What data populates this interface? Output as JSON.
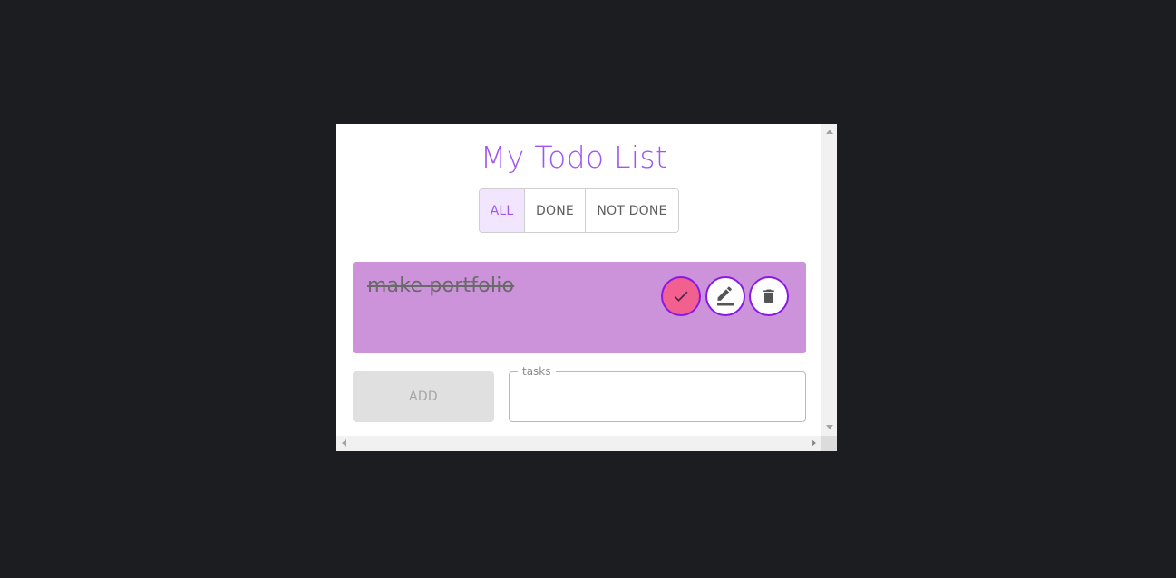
{
  "app": {
    "title": "My Todo List"
  },
  "filters": {
    "all": "ALL",
    "done": "DONE",
    "not_done": "NOT DONE",
    "active": "all"
  },
  "tasks": [
    {
      "text": "make portfolio",
      "completed": true
    }
  ],
  "actions": {
    "check_icon": "check-icon",
    "edit_icon": "pencil-icon",
    "delete_icon": "trash-icon"
  },
  "form": {
    "add_label": "ADD",
    "task_field_label": "tasks",
    "task_field_value": ""
  },
  "colors": {
    "accent": "#a155f0",
    "card_bg": "#cd93da",
    "check_bg": "#f1608e",
    "button_border": "#8a18e6"
  }
}
